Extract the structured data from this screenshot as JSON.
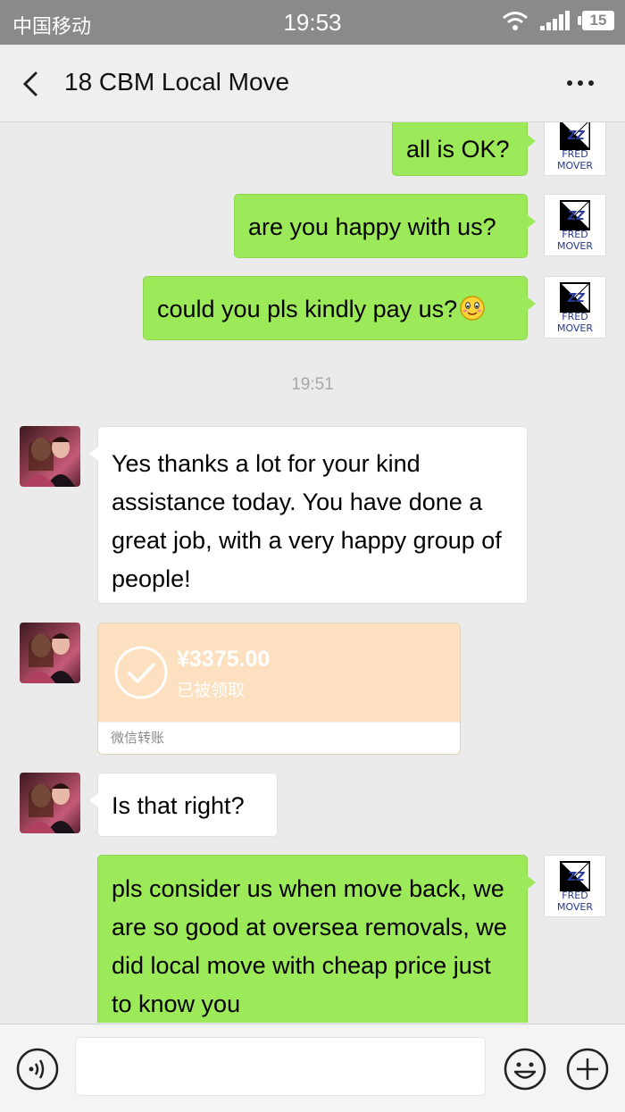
{
  "status_bar": {
    "carrier": "中国移动",
    "time": "19:53",
    "battery": "15"
  },
  "header": {
    "title": "18 CBM Local Move"
  },
  "sent_avatar": {
    "line1": "FRED",
    "line2": "MOVER"
  },
  "messages": [
    {
      "side": "me",
      "text": "all is OK?"
    },
    {
      "side": "me",
      "text": "are you happy with us?"
    },
    {
      "side": "me",
      "text": "could you pls kindly pay us?"
    },
    {
      "side": "them",
      "text": "Yes thanks a lot for your kind assistance today. You have done a great job, with a very happy group of people!"
    },
    {
      "side": "them",
      "text": "Is that right?"
    },
    {
      "side": "me",
      "text": "pls consider us when move back, we are so good at oversea removals, we did local move with cheap price just to know you"
    }
  ],
  "time_divider": "19:51",
  "transfer": {
    "amount": "¥3375.00",
    "status": "已被领取",
    "label": "微信转账",
    "accent": "#fde0c0"
  },
  "colors": {
    "sent_bubble": "#9ce959",
    "received_bubble": "#ffffff",
    "background": "#ebebeb"
  },
  "input_bar": {
    "placeholder": ""
  }
}
